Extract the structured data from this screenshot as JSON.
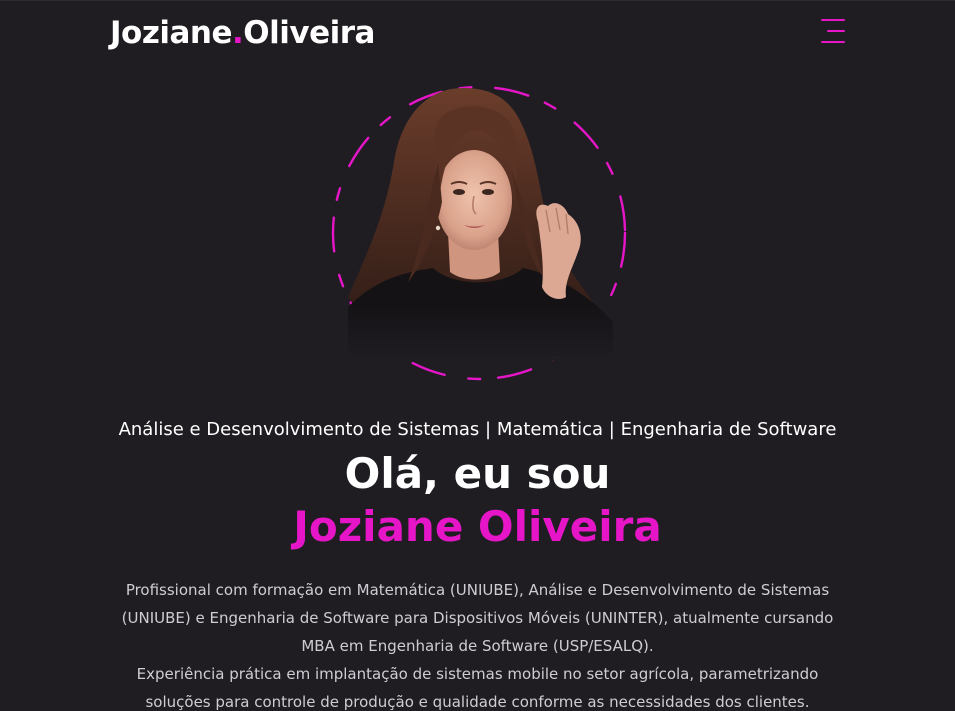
{
  "header": {
    "logo_first": "Joziane",
    "logo_dot": ".",
    "logo_last": "Oliveira",
    "menu_icon": "hamburger-menu-icon"
  },
  "hero": {
    "subtitle": "Análise e Desenvolvimento de Sistemas | Matemática | Engenharia de Software",
    "greeting": "Olá, eu sou",
    "name": "Joziane Oliveira",
    "bio_paragraph_1": "Profissional com formação em Matemática (UNIUBE), Análise e Desenvolvimento de Sistemas (UNIUBE) e Engenharia de Software para Dispositivos Móveis (UNINTER), atualmente cursando MBA em Engenharia de Software (USP/ESALQ).",
    "bio_paragraph_2": "Experiência prática em implantação de sistemas mobile no setor agrícola, parametrizando soluções para controle de produção e qualidade conforme as necessidades dos clientes. Atuante no"
  },
  "colors": {
    "background": "#1f1d22",
    "accent": "#e616c8",
    "text": "#ffffff",
    "muted_text": "#cfcdd3"
  }
}
